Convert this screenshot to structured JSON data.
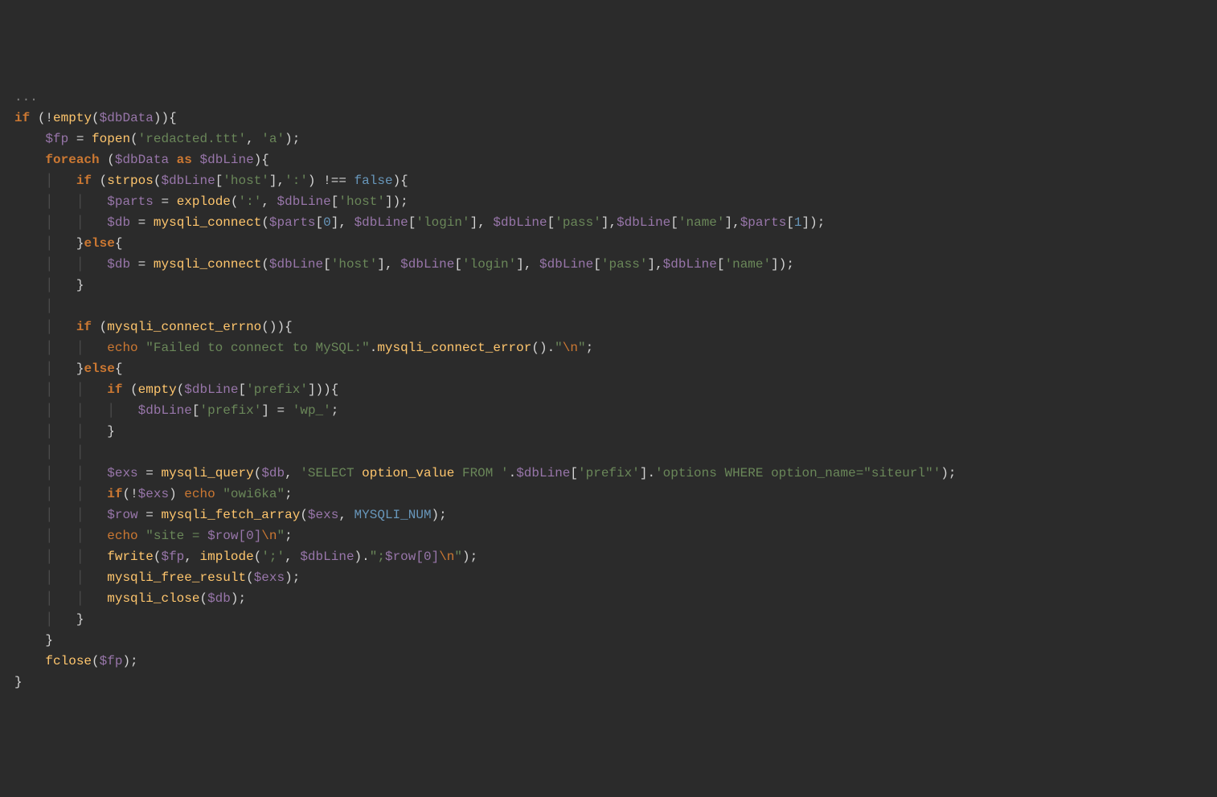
{
  "code": {
    "ellipsis": "...",
    "kw_if": "if",
    "kw_else": "else",
    "kw_foreach": "foreach",
    "kw_as": "as",
    "kw_echo": "echo",
    "fn_empty": "empty",
    "fn_fopen": "fopen",
    "fn_strpos": "strpos",
    "fn_explode": "explode",
    "fn_mysqli_connect": "mysqli_connect",
    "fn_mysqli_connect_errno": "mysqli_connect_errno",
    "fn_mysqli_connect_error": "mysqli_connect_error",
    "fn_mysqli_query": "mysqli_query",
    "fn_mysqli_fetch_array": "mysqli_fetch_array",
    "fn_fwrite": "fwrite",
    "fn_implode": "implode",
    "fn_mysqli_free_result": "mysqli_free_result",
    "fn_mysqli_close": "mysqli_close",
    "fn_fclose": "fclose",
    "const_false": "false",
    "const_mysqli_num": "MYSQLI_NUM",
    "op_not_identical": "!==",
    "op_assign": "=",
    "op_concat": ".",
    "op_not": "!",
    "var_dbData": "$dbData",
    "var_fp": "$fp",
    "var_dbLine": "$dbLine",
    "var_parts": "$parts",
    "var_db": "$db",
    "var_exs": "$exs",
    "var_row": "$row",
    "str_redacted": "'redacted.ttt'",
    "str_a": "'a'",
    "str_host": "'host'",
    "str_colon": "':'",
    "str_login": "'login'",
    "str_pass": "'pass'",
    "str_name": "'name'",
    "str_prefix": "'prefix'",
    "str_wp": "'wp_'",
    "str_semicolon": "';'",
    "str_failed_part1": "\"Failed to connect to MySQL:\"",
    "str_nl": "\"",
    "esc_nl": "\\n",
    "str_nl_end": "\"",
    "str_select_part1": "'SELECT ",
    "str_select_option_value": "option_value",
    "str_select_from": " FROM '",
    "str_options_where": "'options WHERE option_name=\"siteurl\"'",
    "str_owi6ka": "\"owi6ka\"",
    "str_site_eq_part1": "\"site = ",
    "str_site_row": "$row[0]",
    "str_end1": "\"",
    "str_fwrite_part1": "\";",
    "str_fwrite_row": "$row[0]",
    "num_0": "0",
    "num_1": "1"
  }
}
